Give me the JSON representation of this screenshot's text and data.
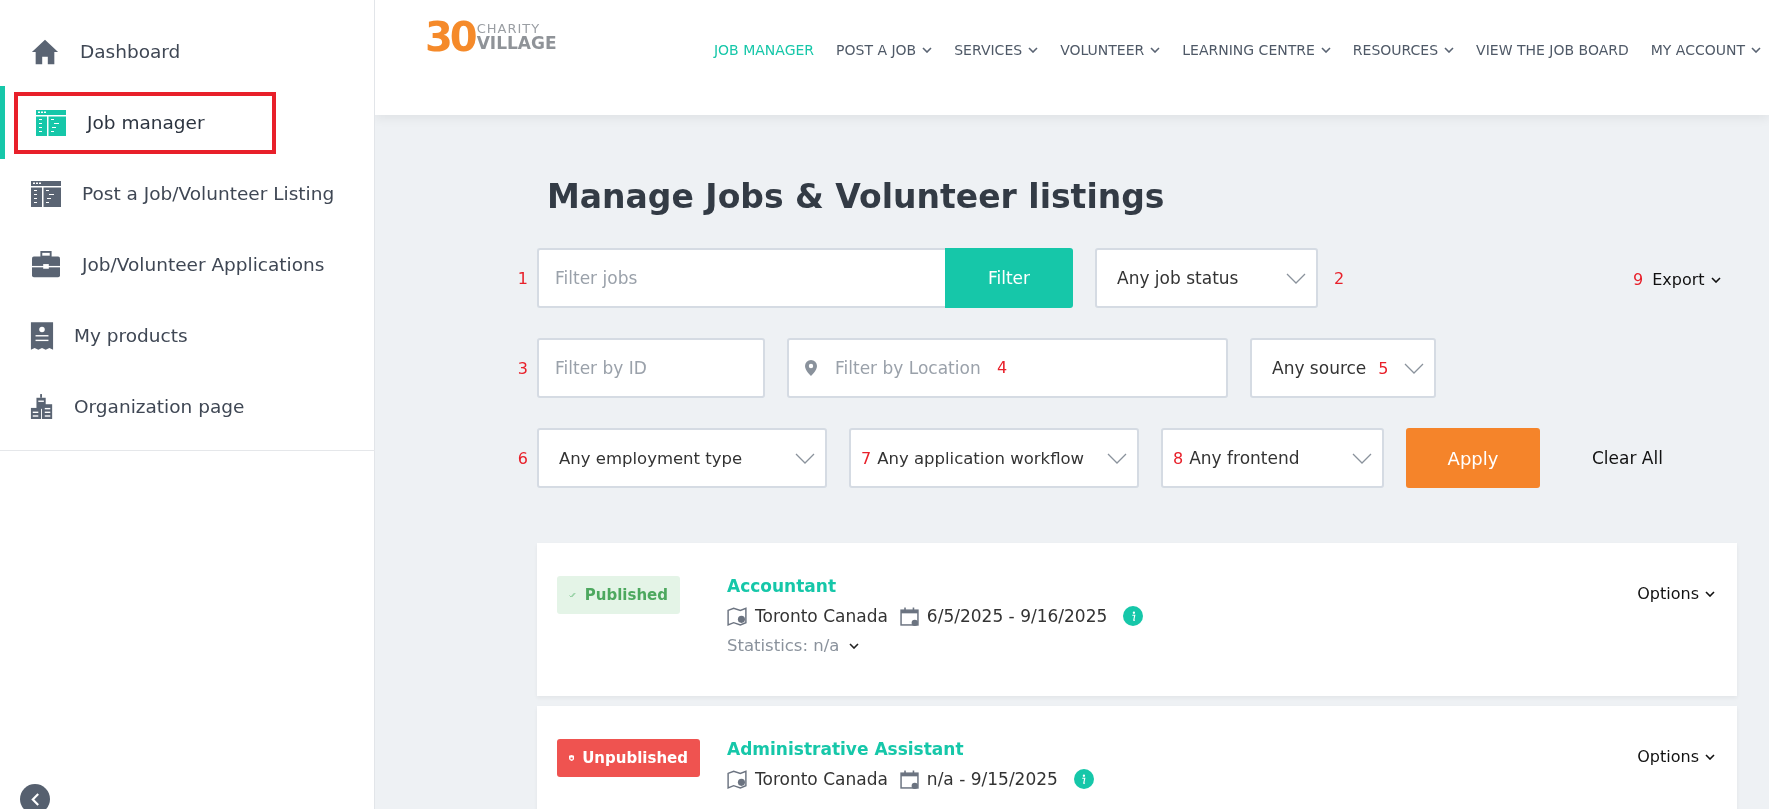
{
  "sidebar": {
    "items": [
      {
        "label": "Dashboard",
        "selected": false,
        "outlined": false
      },
      {
        "label": "Job manager",
        "selected": true,
        "outlined": true
      },
      {
        "label": "Post a Job/Volunteer Listing",
        "selected": false,
        "outlined": false
      },
      {
        "label": "Job/Volunteer Applications",
        "selected": false,
        "outlined": false
      },
      {
        "label": "My products",
        "selected": false,
        "outlined": false
      },
      {
        "label": "Organization page",
        "selected": false,
        "outlined": false
      }
    ]
  },
  "logo": {
    "number": "30",
    "line1": "CHARITY",
    "line2": "VILLAGE"
  },
  "nav": [
    {
      "label": "JOB MANAGER",
      "selected": true,
      "dropdown": false
    },
    {
      "label": "POST A JOB",
      "selected": false,
      "dropdown": true
    },
    {
      "label": "SERVICES",
      "selected": false,
      "dropdown": true
    },
    {
      "label": "VOLUNTEER",
      "selected": false,
      "dropdown": true
    },
    {
      "label": "LEARNING CENTRE",
      "selected": false,
      "dropdown": true
    },
    {
      "label": "RESOURCES",
      "selected": false,
      "dropdown": true
    },
    {
      "label": "VIEW THE JOB BOARD",
      "selected": false,
      "dropdown": false
    },
    {
      "label": "MY ACCOUNT",
      "selected": false,
      "dropdown": true
    }
  ],
  "page_title": "Manage Jobs & Volunteer listings",
  "filter_rows": [
    [
      {
        "kind": "marker",
        "text": "1"
      },
      {
        "kind": "search",
        "placeholder": "Filter jobs",
        "button": "Filter"
      },
      {
        "kind": "select",
        "text": "Any job status"
      },
      {
        "kind": "marker",
        "text": "2"
      }
    ],
    [
      {
        "kind": "marker",
        "text": "3"
      },
      {
        "kind": "input",
        "placeholder": "Filter by ID"
      },
      {
        "kind": "location",
        "placeholder": "Filter by Location",
        "marker": "4"
      },
      {
        "kind": "select",
        "text": "Any source",
        "marker": "5"
      }
    ],
    [
      {
        "kind": "marker",
        "text": "6"
      },
      {
        "kind": "select",
        "text": "Any employment type"
      },
      {
        "kind": "select",
        "lead": "7",
        "text": "Any application workflow"
      },
      {
        "kind": "select",
        "lead": "8",
        "text": "Any frontend"
      },
      {
        "kind": "apply",
        "text": "Apply"
      },
      {
        "kind": "link",
        "text": "Clear All"
      }
    ]
  ],
  "export": {
    "marker": "9",
    "label": "Export"
  },
  "jobs": [
    {
      "published": true,
      "badge": "Published",
      "title": "Accountant",
      "location": "Toronto Canada",
      "dates": "6/5/2025 - 9/16/2025",
      "statistics": "Statistics: n/a",
      "options": "Options"
    },
    {
      "published": false,
      "badge": "Unpublished",
      "title": "Administrative Assistant",
      "location": "Toronto Canada",
      "dates": "n/a - 9/15/2025",
      "options": "Options"
    }
  ]
}
